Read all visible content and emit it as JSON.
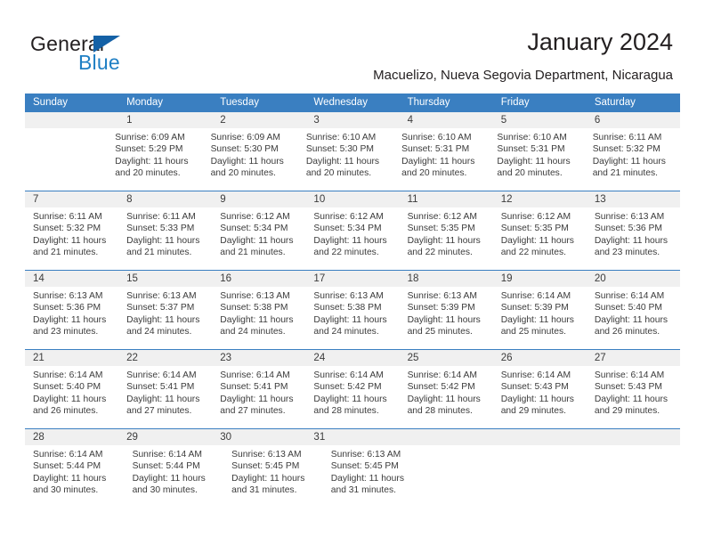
{
  "logo": {
    "word1": "General",
    "word2": "Blue",
    "triangle_color": "#1461a6",
    "blue_color": "#1f7fc4"
  },
  "header": {
    "title": "January 2024",
    "subtitle": "Macuelizo, Nueva Segovia Department, Nicaragua"
  },
  "calendar": {
    "header_color": "#3a7fc1",
    "daynum_bg": "#f0f0f0",
    "weekdays": [
      "Sunday",
      "Monday",
      "Tuesday",
      "Wednesday",
      "Thursday",
      "Friday",
      "Saturday"
    ],
    "weeks": [
      {
        "days": [
          {
            "num": "",
            "lines": []
          },
          {
            "num": "1",
            "lines": [
              "Sunrise: 6:09 AM",
              "Sunset: 5:29 PM",
              "Daylight: 11 hours and 20 minutes."
            ]
          },
          {
            "num": "2",
            "lines": [
              "Sunrise: 6:09 AM",
              "Sunset: 5:30 PM",
              "Daylight: 11 hours and 20 minutes."
            ]
          },
          {
            "num": "3",
            "lines": [
              "Sunrise: 6:10 AM",
              "Sunset: 5:30 PM",
              "Daylight: 11 hours and 20 minutes."
            ]
          },
          {
            "num": "4",
            "lines": [
              "Sunrise: 6:10 AM",
              "Sunset: 5:31 PM",
              "Daylight: 11 hours and 20 minutes."
            ]
          },
          {
            "num": "5",
            "lines": [
              "Sunrise: 6:10 AM",
              "Sunset: 5:31 PM",
              "Daylight: 11 hours and 20 minutes."
            ]
          },
          {
            "num": "6",
            "lines": [
              "Sunrise: 6:11 AM",
              "Sunset: 5:32 PM",
              "Daylight: 11 hours and 21 minutes."
            ]
          }
        ]
      },
      {
        "days": [
          {
            "num": "7",
            "lines": [
              "Sunrise: 6:11 AM",
              "Sunset: 5:32 PM",
              "Daylight: 11 hours and 21 minutes."
            ]
          },
          {
            "num": "8",
            "lines": [
              "Sunrise: 6:11 AM",
              "Sunset: 5:33 PM",
              "Daylight: 11 hours and 21 minutes."
            ]
          },
          {
            "num": "9",
            "lines": [
              "Sunrise: 6:12 AM",
              "Sunset: 5:34 PM",
              "Daylight: 11 hours and 21 minutes."
            ]
          },
          {
            "num": "10",
            "lines": [
              "Sunrise: 6:12 AM",
              "Sunset: 5:34 PM",
              "Daylight: 11 hours and 22 minutes."
            ]
          },
          {
            "num": "11",
            "lines": [
              "Sunrise: 6:12 AM",
              "Sunset: 5:35 PM",
              "Daylight: 11 hours and 22 minutes."
            ]
          },
          {
            "num": "12",
            "lines": [
              "Sunrise: 6:12 AM",
              "Sunset: 5:35 PM",
              "Daylight: 11 hours and 22 minutes."
            ]
          },
          {
            "num": "13",
            "lines": [
              "Sunrise: 6:13 AM",
              "Sunset: 5:36 PM",
              "Daylight: 11 hours and 23 minutes."
            ]
          }
        ]
      },
      {
        "days": [
          {
            "num": "14",
            "lines": [
              "Sunrise: 6:13 AM",
              "Sunset: 5:36 PM",
              "Daylight: 11 hours and 23 minutes."
            ]
          },
          {
            "num": "15",
            "lines": [
              "Sunrise: 6:13 AM",
              "Sunset: 5:37 PM",
              "Daylight: 11 hours and 24 minutes."
            ]
          },
          {
            "num": "16",
            "lines": [
              "Sunrise: 6:13 AM",
              "Sunset: 5:38 PM",
              "Daylight: 11 hours and 24 minutes."
            ]
          },
          {
            "num": "17",
            "lines": [
              "Sunrise: 6:13 AM",
              "Sunset: 5:38 PM",
              "Daylight: 11 hours and 24 minutes."
            ]
          },
          {
            "num": "18",
            "lines": [
              "Sunrise: 6:13 AM",
              "Sunset: 5:39 PM",
              "Daylight: 11 hours and 25 minutes."
            ]
          },
          {
            "num": "19",
            "lines": [
              "Sunrise: 6:14 AM",
              "Sunset: 5:39 PM",
              "Daylight: 11 hours and 25 minutes."
            ]
          },
          {
            "num": "20",
            "lines": [
              "Sunrise: 6:14 AM",
              "Sunset: 5:40 PM",
              "Daylight: 11 hours and 26 minutes."
            ]
          }
        ]
      },
      {
        "days": [
          {
            "num": "21",
            "lines": [
              "Sunrise: 6:14 AM",
              "Sunset: 5:40 PM",
              "Daylight: 11 hours and 26 minutes."
            ]
          },
          {
            "num": "22",
            "lines": [
              "Sunrise: 6:14 AM",
              "Sunset: 5:41 PM",
              "Daylight: 11 hours and 27 minutes."
            ]
          },
          {
            "num": "23",
            "lines": [
              "Sunrise: 6:14 AM",
              "Sunset: 5:41 PM",
              "Daylight: 11 hours and 27 minutes."
            ]
          },
          {
            "num": "24",
            "lines": [
              "Sunrise: 6:14 AM",
              "Sunset: 5:42 PM",
              "Daylight: 11 hours and 28 minutes."
            ]
          },
          {
            "num": "25",
            "lines": [
              "Sunrise: 6:14 AM",
              "Sunset: 5:42 PM",
              "Daylight: 11 hours and 28 minutes."
            ]
          },
          {
            "num": "26",
            "lines": [
              "Sunrise: 6:14 AM",
              "Sunset: 5:43 PM",
              "Daylight: 11 hours and 29 minutes."
            ]
          },
          {
            "num": "27",
            "lines": [
              "Sunrise: 6:14 AM",
              "Sunset: 5:43 PM",
              "Daylight: 11 hours and 29 minutes."
            ]
          }
        ]
      },
      {
        "days": [
          {
            "num": "28",
            "lines": [
              "Sunrise: 6:14 AM",
              "Sunset: 5:44 PM",
              "Daylight: 11 hours and 30 minutes."
            ]
          },
          {
            "num": "29",
            "lines": [
              "Sunrise: 6:14 AM",
              "Sunset: 5:44 PM",
              "Daylight: 11 hours and 30 minutes."
            ]
          },
          {
            "num": "30",
            "lines": [
              "Sunrise: 6:13 AM",
              "Sunset: 5:45 PM",
              "Daylight: 11 hours and 31 minutes."
            ]
          },
          {
            "num": "31",
            "lines": [
              "Sunrise: 6:13 AM",
              "Sunset: 5:45 PM",
              "Daylight: 11 hours and 31 minutes."
            ]
          },
          {
            "num": "",
            "lines": []
          },
          {
            "num": "",
            "lines": []
          },
          {
            "num": "",
            "lines": []
          }
        ]
      }
    ]
  }
}
